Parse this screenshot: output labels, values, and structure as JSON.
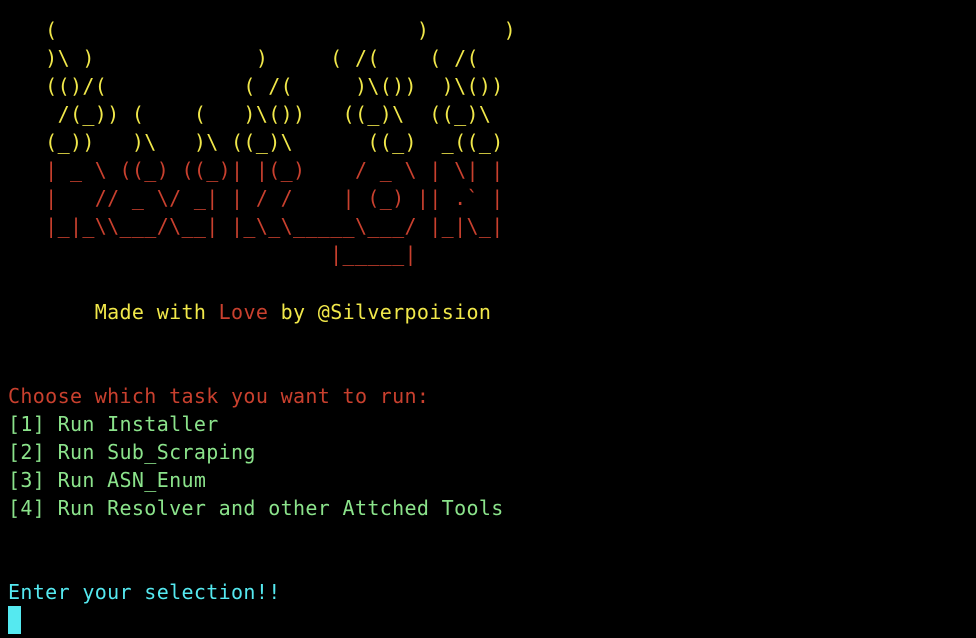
{
  "terminal": {
    "banner_top": [
      "   (                             )      )",
      "   )\\ )             )     ( /(    ( /(",
      "   (()/(           ( /(     )\\())  )\\())",
      "    /(_)) (    (   )\\())   ((_)\\  ((_)\\",
      "   (_))   )\\   )\\ ((_)\\      ((_)  _((_)"
    ],
    "banner_bottom": [
      "   | _ \\ ((_) ((_)| |(_)    / _ \\ | \\| |",
      "   |   // _ \\/ _| | / /    | (_) || .` |",
      "   |_|_\\\\___/\\__| |_\\_\\_____\\___/ |_|\\_|",
      "                          |_____|"
    ],
    "tagline": {
      "prefix": "       Made with ",
      "love": "Love",
      "suffix": " by @Silverpoision"
    },
    "menu_prompt": "Choose which task you want to run:",
    "menu_options": [
      "[1] Run Installer",
      "[2] Run Sub_Scraping",
      "[3] Run ASN_Enum",
      "[4] Run Resolver and other Attched Tools"
    ],
    "input_prompt": "Enter your selection!!",
    "colors": {
      "background": "#000000",
      "banner_yellow": "#f1e84a",
      "banner_red": "#c9402e",
      "menu_green": "#8be38b",
      "prompt_cyan": "#55e9f0"
    }
  }
}
